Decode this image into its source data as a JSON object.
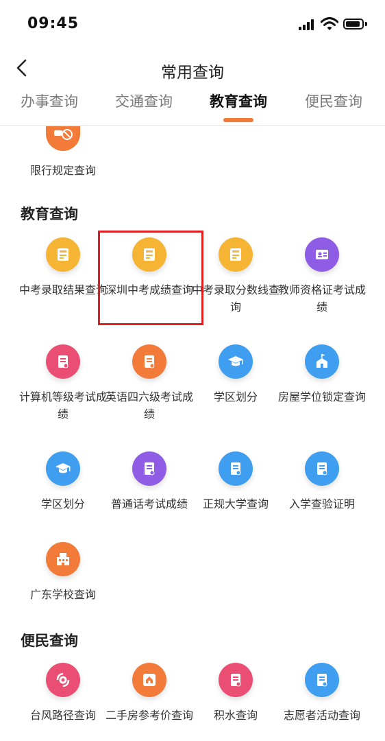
{
  "status": {
    "time": "09:45"
  },
  "header": {
    "title": "常用查询",
    "back_label": "<"
  },
  "tabs": [
    {
      "label": "办事查询",
      "active": false
    },
    {
      "label": "交通查询",
      "active": false
    },
    {
      "label": "教育查询",
      "active": true
    },
    {
      "label": "便民查询",
      "active": false
    }
  ],
  "partial_item": {
    "label": "限行规定查询",
    "icon": "no-car-icon",
    "color": "#f37b3a"
  },
  "sections": [
    {
      "title": "教育查询",
      "items": [
        {
          "label": "中考录取结果查询",
          "icon": "exam-book-icon",
          "color": "#f5b433"
        },
        {
          "label": "深圳中考成绩查询",
          "icon": "exam-book-icon",
          "color": "#f5b433",
          "highlighted": true
        },
        {
          "label": "中考录取分数线查询",
          "icon": "exam-book-icon",
          "color": "#f5b433"
        },
        {
          "label": "教师资格证考试成绩",
          "icon": "id-card-icon",
          "color": "#8f5ce6"
        },
        {
          "label": "计算机等级考试成绩",
          "icon": "document-icon",
          "color": "#ea4f73"
        },
        {
          "label": "英语四六级考试成绩",
          "icon": "document-icon",
          "color": "#f37b3a"
        },
        {
          "label": "学区划分",
          "icon": "graduation-cap-icon",
          "color": "#3f9ef0"
        },
        {
          "label": "房屋学位锁定查询",
          "icon": "school-building-icon",
          "color": "#3f9ef0"
        },
        {
          "label": "学区划分",
          "icon": "graduation-cap-icon",
          "color": "#3f9ef0"
        },
        {
          "label": "普通话考试成绩",
          "icon": "document-icon",
          "color": "#8f5ce6"
        },
        {
          "label": "正规大学查询",
          "icon": "document-icon",
          "color": "#3f9ef0"
        },
        {
          "label": "入学查验证明",
          "icon": "document-icon",
          "color": "#3f9ef0"
        },
        {
          "label": "广东学校查询",
          "icon": "building-icon",
          "color": "#f37b3a"
        }
      ]
    },
    {
      "title": "便民查询",
      "items": [
        {
          "label": "台风路径查询",
          "icon": "typhoon-icon",
          "color": "#ea4f73"
        },
        {
          "label": "二手房参考价查询",
          "icon": "house-icon",
          "color": "#f37b3a"
        },
        {
          "label": "积水查询",
          "icon": "document-icon",
          "color": "#ea4f73"
        },
        {
          "label": "志愿者活动查询",
          "icon": "document-icon",
          "color": "#3f9ef0"
        }
      ]
    }
  ],
  "colors": {
    "accent": "#f37b3a",
    "highlight": "#e02020"
  }
}
